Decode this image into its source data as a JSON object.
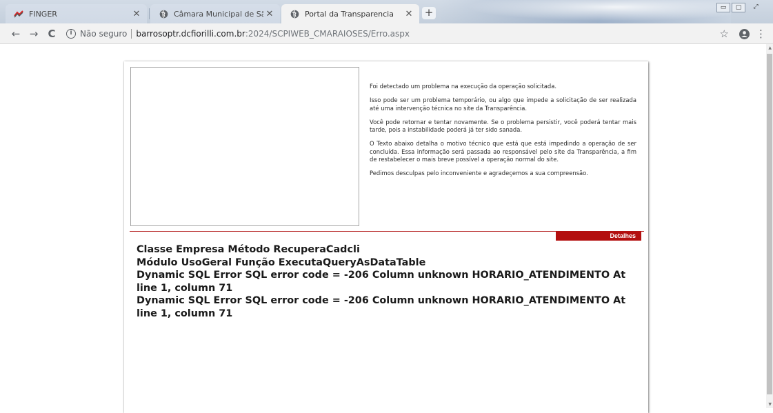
{
  "browser": {
    "tabs": [
      {
        "title": "FINGER",
        "icon": "finger-logo-icon"
      },
      {
        "title": "Câmara Municipal de São João d",
        "icon": "globe-icon"
      },
      {
        "title": "Portal da Transparencia",
        "icon": "globe-icon"
      }
    ],
    "new_tab": "+",
    "window_buttons": {
      "minimize": "▭",
      "maximize": "▢",
      "close": "⤢"
    }
  },
  "addressbar": {
    "security_label": "Não seguro",
    "url_host": "barrosoptr.dcfiorilli.com.br",
    "url_path": ":2024/SCPIWEB_CMARAIOSES/Erro.aspx"
  },
  "page": {
    "message": [
      "Foi detectado um problema na execução da operação solicitada.",
      "Isso pode ser um problema temporário, ou algo que impede a solicitação de ser realizada até uma intervenção técnica no site da Transparência.",
      "Você pode retornar e tentar novamente. Se o problema persistir, você poderá tentar mais tarde, pois a instabilidade poderá já ter sido sanada.",
      "O Texto abaixo detalha o motivo técnico que está que está impedindo a operação de ser concluída. Essa informação será passada ao responsável pelo site da Transparência, a fim de restabelecer o mais breve possível a operação normal do site.",
      "Pedimos desculpas pelo inconveniente e agradeçemos a sua compreensão."
    ],
    "details_label": "Detalhes",
    "error_lines": [
      "Classe Empresa Método RecuperaCadcli",
      "Módulo UsoGeral Função ExecutaQueryAsDataTable",
      "Dynamic SQL Error SQL error code = -206 Column unknown HORARIO_ATENDIMENTO At line 1, column 71",
      "Dynamic SQL Error SQL error code = -206 Column unknown HORARIO_ATENDIMENTO At line 1, column 71"
    ]
  },
  "colors": {
    "accent_red": "#b30f0f",
    "tabstrip": "#c4cfdc"
  }
}
